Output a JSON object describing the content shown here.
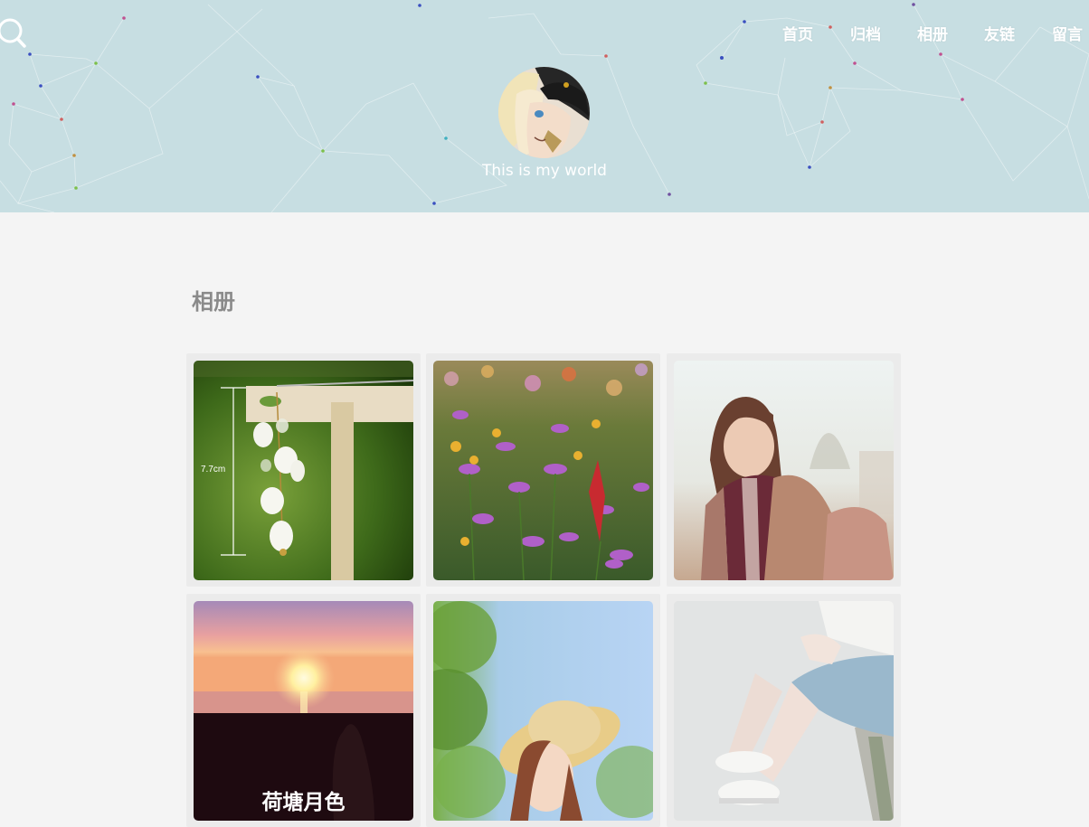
{
  "header": {
    "nav": [
      {
        "label": "首页"
      },
      {
        "label": "归档"
      },
      {
        "label": "相册"
      },
      {
        "label": "友链"
      },
      {
        "label": "留言"
      }
    ],
    "motto": "This is my world",
    "search_icon": "search-icon",
    "background_color": "#c7dee2"
  },
  "main": {
    "title": "相册",
    "photos": [
      {
        "subject": "lily-of-the-valley-earring",
        "overlay_text": "7.7cm"
      },
      {
        "subject": "wildflower-field"
      },
      {
        "subject": "girl-with-scarf"
      },
      {
        "subject": "sunset-sea",
        "caption": "荷塘月色"
      },
      {
        "subject": "girl-in-straw-hat"
      },
      {
        "subject": "girl-sitting-white-sneakers"
      }
    ]
  }
}
